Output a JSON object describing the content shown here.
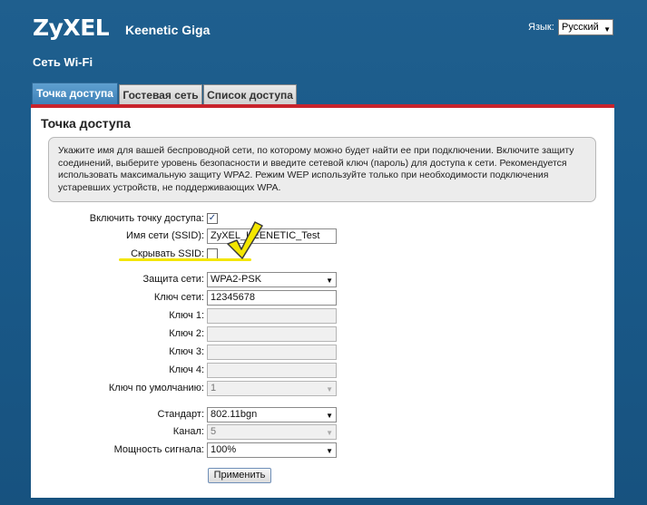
{
  "header": {
    "logo": "ZyXEL",
    "model": "Keenetic Giga",
    "language_label": "Язык:",
    "language_value": "Русский"
  },
  "page_title": "Сеть Wi-Fi",
  "tabs": [
    {
      "label": "Точка доступа",
      "active": true
    },
    {
      "label": "Гостевая сеть",
      "active": false
    },
    {
      "label": "Список доступа",
      "active": false
    }
  ],
  "panel": {
    "title": "Точка доступа",
    "info_text": "Укажите имя для вашей беспроводной сети, по которому можно будет найти ее при подключении. Включите защиту соединений, выберите уровень безопасности и введите сетевой ключ (пароль) для доступа к сети. Рекомендуется использовать максимальную защиту WPA2. Режим WEP используйте только при необходимости подключения устаревших устройств, не поддерживающих WPA."
  },
  "form": {
    "enable_ap": {
      "label": "Включить точку доступа:",
      "checked": true
    },
    "ssid": {
      "label": "Имя сети (SSID):",
      "value": "ZyXEL_KEENETIC_Test"
    },
    "hide_ssid": {
      "label": "Скрывать SSID:",
      "checked": false
    },
    "security": {
      "label": "Защита сети:",
      "value": "WPA2-PSK"
    },
    "network_key": {
      "label": "Ключ сети:",
      "value": "12345678"
    },
    "key1": {
      "label": "Ключ 1:",
      "value": ""
    },
    "key2": {
      "label": "Ключ 2:",
      "value": ""
    },
    "key3": {
      "label": "Ключ 3:",
      "value": ""
    },
    "key4": {
      "label": "Ключ 4:",
      "value": ""
    },
    "default_key": {
      "label": "Ключ по умолчанию:",
      "value": "1"
    },
    "standard": {
      "label": "Стандарт:",
      "value": "802.11bgn"
    },
    "channel": {
      "label": "Канал:",
      "value": "5"
    },
    "power": {
      "label": "Мощность сигнала:",
      "value": "100%"
    },
    "apply_label": "Применить"
  },
  "annotation": {
    "highlight_color": "#f3e600"
  },
  "colors": {
    "accent": "#c8232c",
    "background": "#1f5f8e",
    "active_tab": "#3c7fb6"
  }
}
